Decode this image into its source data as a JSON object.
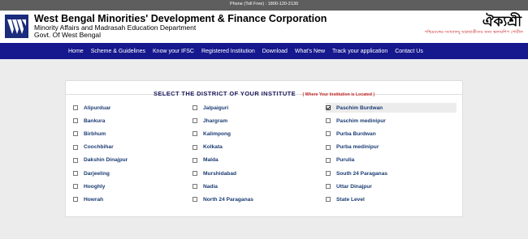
{
  "topbar": {
    "phone": "Phone (Toll Free) : 1800-120-2130"
  },
  "header": {
    "title": "West Bengal Minorities' Development & Finance Corporation",
    "department": "Minority Affairs and Madrasah Education Department",
    "govt": "Govt. Of West Bengal",
    "portal_name": "ঐক্যশ্রী",
    "portal_subtitle": "পশ্চিমবঙ্গের সংখ্যালঘু ছাত্রছাত্রীদের জন্য স্কলারশিপ পোর্টাল"
  },
  "nav": {
    "items": [
      {
        "label": "Home"
      },
      {
        "label": "Scheme & Guidelines"
      },
      {
        "label": "Know your IFSC"
      },
      {
        "label": "Registered Institution"
      },
      {
        "label": "Download"
      },
      {
        "label": "What's New"
      },
      {
        "label": "Track your application"
      },
      {
        "label": "Contact Us"
      }
    ]
  },
  "panel": {
    "title": "SELECT THE DISTRICT OF YOUR INSTITUTE",
    "hint": "( Where Your Institution is Located )"
  },
  "districts": {
    "rows": [
      [
        "Alipurduar",
        "Jalpaiguri",
        "Paschim Burdwan"
      ],
      [
        "Bankura",
        "Jhargram",
        "Paschim medinipur"
      ],
      [
        "Birbhum",
        "Kalimpong",
        "Purba Burdwan"
      ],
      [
        "Coochbihar",
        "Kolkata",
        "Purba medinipur"
      ],
      [
        "Dakshin Dinajpur",
        "Malda",
        "Purulia"
      ],
      [
        "Darjeeling",
        "Murshidabad",
        "South 24 Paraganas"
      ],
      [
        "Hooghly",
        "Nadia",
        "Uttar Dinajpur"
      ],
      [
        "Howrah",
        "North 24 Paraganas",
        "State Level"
      ]
    ],
    "selected": "Paschim Burdwan"
  }
}
